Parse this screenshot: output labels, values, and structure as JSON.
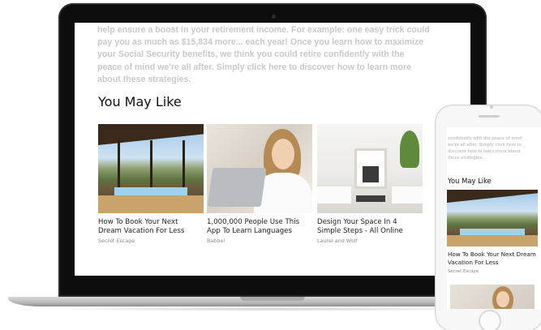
{
  "desktop": {
    "article_lines": [
      "help ensure a boost in your retirement income. For example: one easy trick could",
      "pay you as much as $15,834 more... each year! Once you learn how to maximize",
      "your Social Security benefits, we think you could retire confidently with the",
      "peace of mind we're all after. Simply click here to discover how to learn more",
      "about these strategies."
    ],
    "section_title": "You May Like",
    "cards": [
      {
        "title": "How To Book Your Next Dream Vacation For Less",
        "source": "Secret Escape",
        "image": "vacation-house-pool-photo"
      },
      {
        "title": "1,000,000 People Use This App To Learn Languages",
        "source": "Babbel",
        "image": "woman-with-laptop-photo"
      },
      {
        "title": "Design Your Space In 4 Simple Steps - All Online",
        "source": "Laurel and Wolf",
        "image": "white-living-room-photo"
      }
    ]
  },
  "mobile": {
    "article_lines": [
      "confidently with the peace of mind",
      "we're all after. Simply click here to",
      "discover how to learn more about",
      "these strategies."
    ],
    "section_title": "You May Like",
    "card": {
      "title": "How To Book Your Next Dream Vacation For Less",
      "source": "Secret Escape",
      "image": "vacation-house-pool-photo"
    }
  }
}
